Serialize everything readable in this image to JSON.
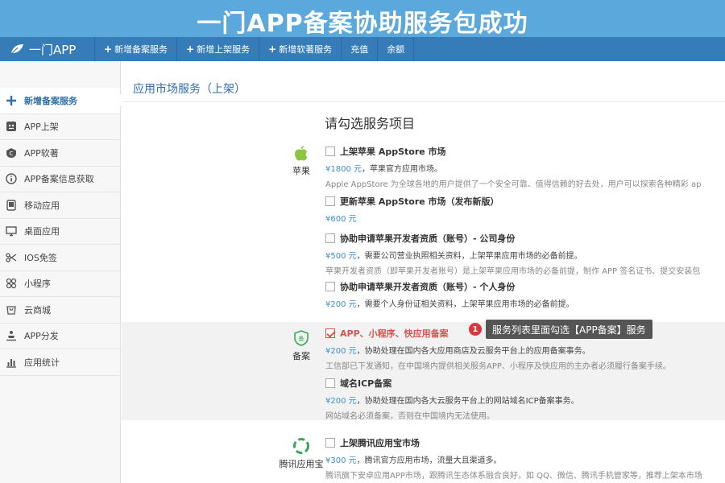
{
  "banner": {
    "title": "一门APP备案协助服务包成功"
  },
  "navbar": {
    "brand": "一门APP",
    "items": [
      {
        "label": "新增备案服务",
        "plus": "+"
      },
      {
        "label": "新增上架服务",
        "plus": "+"
      },
      {
        "label": "新增软著服务",
        "plus": "+"
      },
      {
        "label": "充值",
        "plus": ""
      },
      {
        "label": "余额",
        "plus": ""
      }
    ]
  },
  "sidebar": {
    "items": [
      {
        "label": "新增备案服务",
        "icon": "plus-icon",
        "active": true
      },
      {
        "label": "APP上架",
        "icon": "app-store-icon"
      },
      {
        "label": "APP软著",
        "icon": "copyright-icon"
      },
      {
        "label": "APP备案信息获取",
        "icon": "info-icon"
      },
      {
        "label": "移动应用",
        "icon": "mobile-icon"
      },
      {
        "label": "桌面应用",
        "icon": "desktop-icon"
      },
      {
        "label": "IOS免签",
        "icon": "scissors-icon"
      },
      {
        "label": "小程序",
        "icon": "mini-program-icon"
      },
      {
        "label": "云商城",
        "icon": "cart-icon"
      },
      {
        "label": "APP分发",
        "icon": "distribute-icon"
      },
      {
        "label": "应用统计",
        "icon": "chart-icon"
      }
    ]
  },
  "main": {
    "breadcrumb": "应用市场服务（上架）",
    "section_title": "请勾选服务项目",
    "groups": [
      {
        "category": "苹果",
        "options": [
          {
            "title": "上架苹果 AppStore 市场",
            "price": "¥1800 元",
            "price_note": "，苹果官方应用市场。",
            "desc": "Apple AppStore 为全球各地的用户提供了一个安全可靠、值得信赖的好去处，用户可以探索各种精彩 ap",
            "checked": false
          },
          {
            "title": "更新苹果 AppStore 市场（发布新版）",
            "price": "¥600 元",
            "price_note": "",
            "desc": "",
            "checked": false
          },
          {
            "title": "协助申请苹果开发者资质（账号）- 公司身份",
            "price": "¥500 元",
            "price_note": "，需要公司营业执照相关资料，上架苹果应用市场的必备前提。",
            "desc": "苹果开发者资质（即苹果开发者账号）是上架苹果应用市场的必备前提，制作 APP 签名证书、提交安装包",
            "checked": false
          },
          {
            "title": "协助申请苹果开发者资质（账号）- 个人身份",
            "price": "¥200 元",
            "price_note": "，需要个人身份证相关资料，上架苹果应用市场的必备前提。",
            "desc": "",
            "checked": false
          }
        ]
      },
      {
        "category": "备案",
        "options": [
          {
            "title": "APP、小程序、快应用备案",
            "price": "¥200 元",
            "price_note": "，协助处理在国内各大应用商店及云服务平台上的应用备案事务。",
            "desc": "工信部已下发通知，在中国境内提供相关服务APP、小程序及快应用的主办者必须履行备案手续。",
            "checked": true
          },
          {
            "title": "域名ICP备案",
            "price": "¥200 元",
            "price_note": "，协助处理在国内各大云服务平台上的网站域名ICP备案事务。",
            "desc": "网站域名必须备案，否则在中国境内无法使用。",
            "checked": false
          }
        ]
      },
      {
        "category": "腾讯应用宝",
        "options": [
          {
            "title": "上架腾讯应用宝市场",
            "price": "¥300 元",
            "price_note": "，腾讯官方应用市场，流量大且渠道多。",
            "desc": "腾讯旗下安卓应用APP市场，跟腾讯生态体系融合良好，如 QQ、微信、腾讯手机管家等，推荐上架本市场",
            "checked": false
          }
        ]
      }
    ],
    "tooltip": {
      "badge": "1",
      "text": "服务列表里面勾选【APP备案】服务"
    }
  },
  "colors": {
    "banner": "#5ba9dc",
    "navbar": "#357cb8",
    "accent": "#2f6fa8",
    "price": "#3c8dd0",
    "checked": "#d9534f"
  }
}
